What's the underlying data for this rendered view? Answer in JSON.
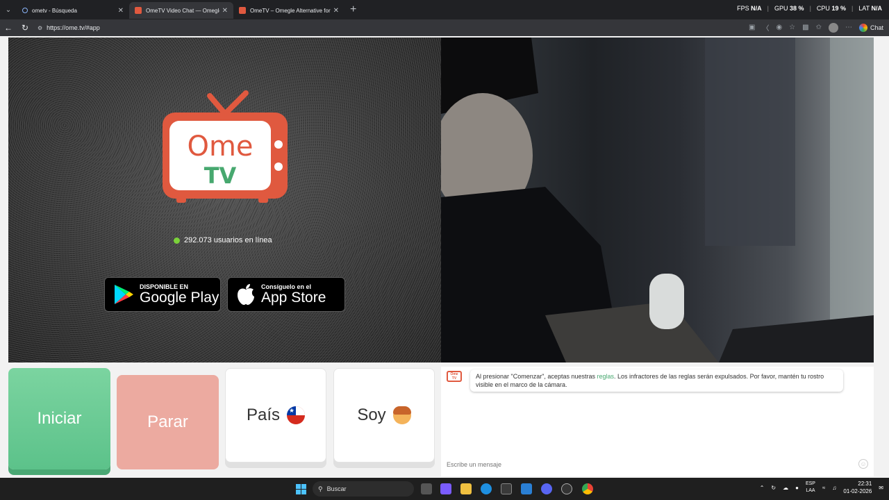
{
  "browser": {
    "tabs": [
      {
        "title": "ometv - Búsqueda"
      },
      {
        "title": "OmeTV Video Chat — Omegle"
      },
      {
        "title": "OmeTV – Omegle Alternative for"
      }
    ],
    "url": "https://ome.tv/#app",
    "chat_label": "Chat",
    "perf": {
      "fps_label": "FPS",
      "fps": "N/A",
      "gpu_label": "GPU",
      "gpu": "38 %",
      "cpu_label": "CPU",
      "cpu": "19 %",
      "lat_label": "LAT",
      "lat": "N/A"
    }
  },
  "app": {
    "logo": {
      "ome": "Ome",
      "tv": "TV"
    },
    "online_text": "292.073 usuarios en línea",
    "google_play": {
      "small": "DISPONIBLE EN",
      "big": "Google Play"
    },
    "app_store": {
      "small": "Consíguelo en el",
      "big": "App Store"
    },
    "buttons": {
      "start": "Iniciar",
      "stop": "Parar",
      "country": "País",
      "gender": "Soy"
    },
    "chat": {
      "notice_pre": "Al presionar \"Comenzar\", aceptas nuestras ",
      "notice_link": "reglas",
      "notice_post": ". Los infractores de las reglas serán expulsados. Por favor, mantén tu rostro visible en el marco de la cámara.",
      "input_placeholder": "Escribe un mensaje"
    },
    "colors": {
      "brand": "#e0593f",
      "brand_green": "#47a86f",
      "start_green": "#5cc28a",
      "stop_red": "#ecaaa0",
      "online_dot": "#7bd23a"
    }
  },
  "taskbar": {
    "search_label": "Buscar",
    "lang_top": "ESP",
    "lang_bottom": "LAA",
    "time": "22:31",
    "date": "01-02-2026"
  }
}
